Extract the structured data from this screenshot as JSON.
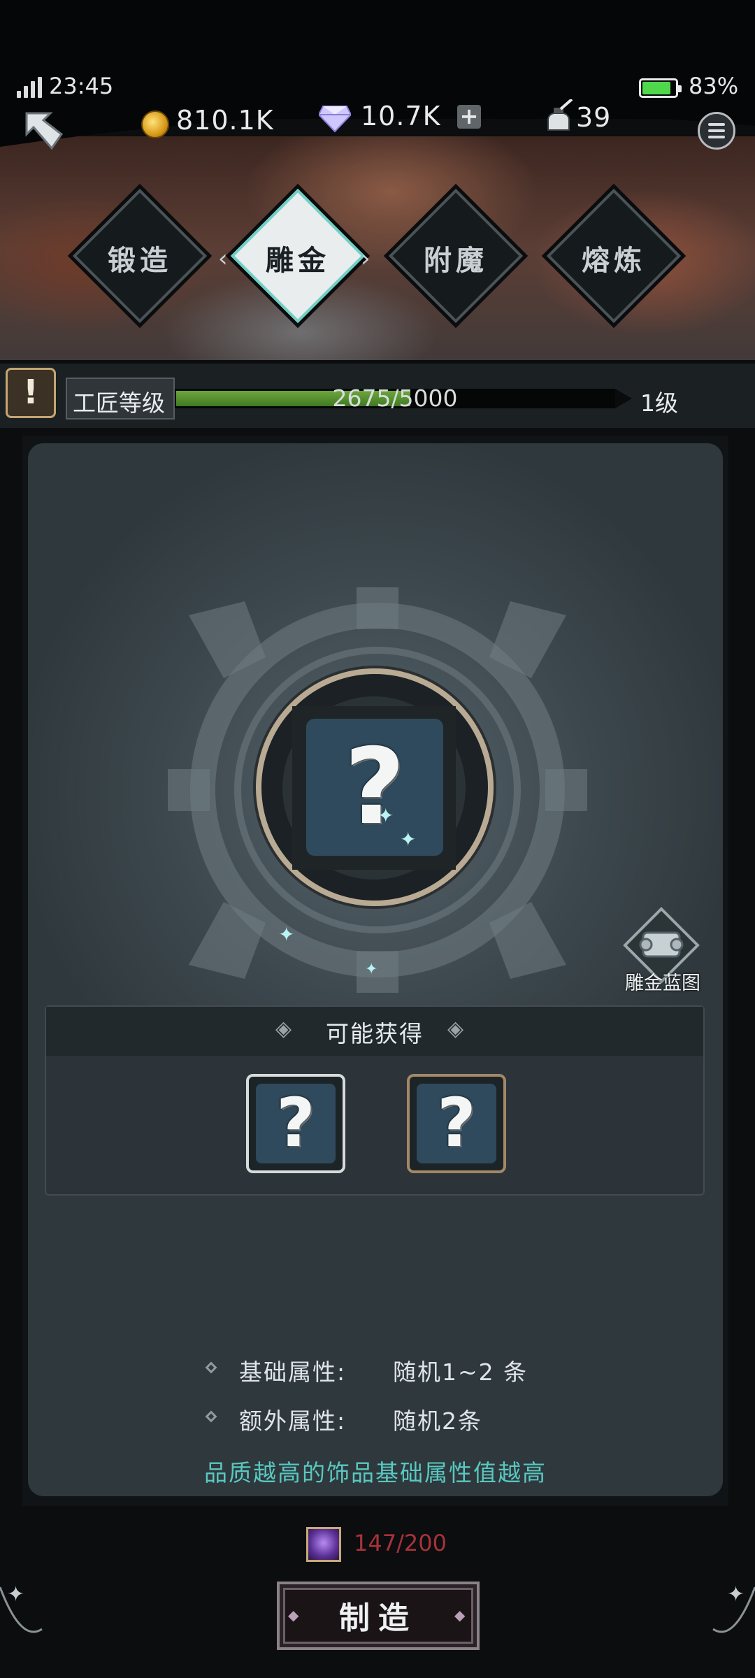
{
  "status_bar": {
    "time": "23:45",
    "battery_pct": "83%"
  },
  "resources": {
    "coins": "810.1K",
    "gems": "10.7K",
    "ink": "39",
    "icons": {
      "coin": "gold-coin-icon",
      "gem": "diamond-gem-icon",
      "ink": "ink-bottle-icon",
      "add": "plus-icon",
      "menu": "menu-icon",
      "back": "back-arrow-icon"
    }
  },
  "tabs": [
    {
      "label": "锻造",
      "active": false
    },
    {
      "label": "雕金",
      "active": true
    },
    {
      "label": "附魔",
      "active": false
    },
    {
      "label": "熔炼",
      "active": false
    }
  ],
  "craftsman": {
    "label": "工匠等级",
    "xp_text": "2675/5000",
    "xp_fraction": 0.535,
    "level": "1级"
  },
  "main": {
    "blueprint_label": "雕金蓝图",
    "possible_rewards_title": "可能获得",
    "attributes": [
      {
        "name": "基础属性:",
        "value": "随机1~2 条"
      },
      {
        "name": "额外属性:",
        "value": "随机2条"
      }
    ],
    "hint": "品质越高的饰品基础属性值越高"
  },
  "craft": {
    "cost": "147/200",
    "button_label": "制造"
  },
  "colors": {
    "accent_teal": "#59c8c0",
    "cost_red": "#a8323a",
    "xp_green": "#5a9a34"
  }
}
